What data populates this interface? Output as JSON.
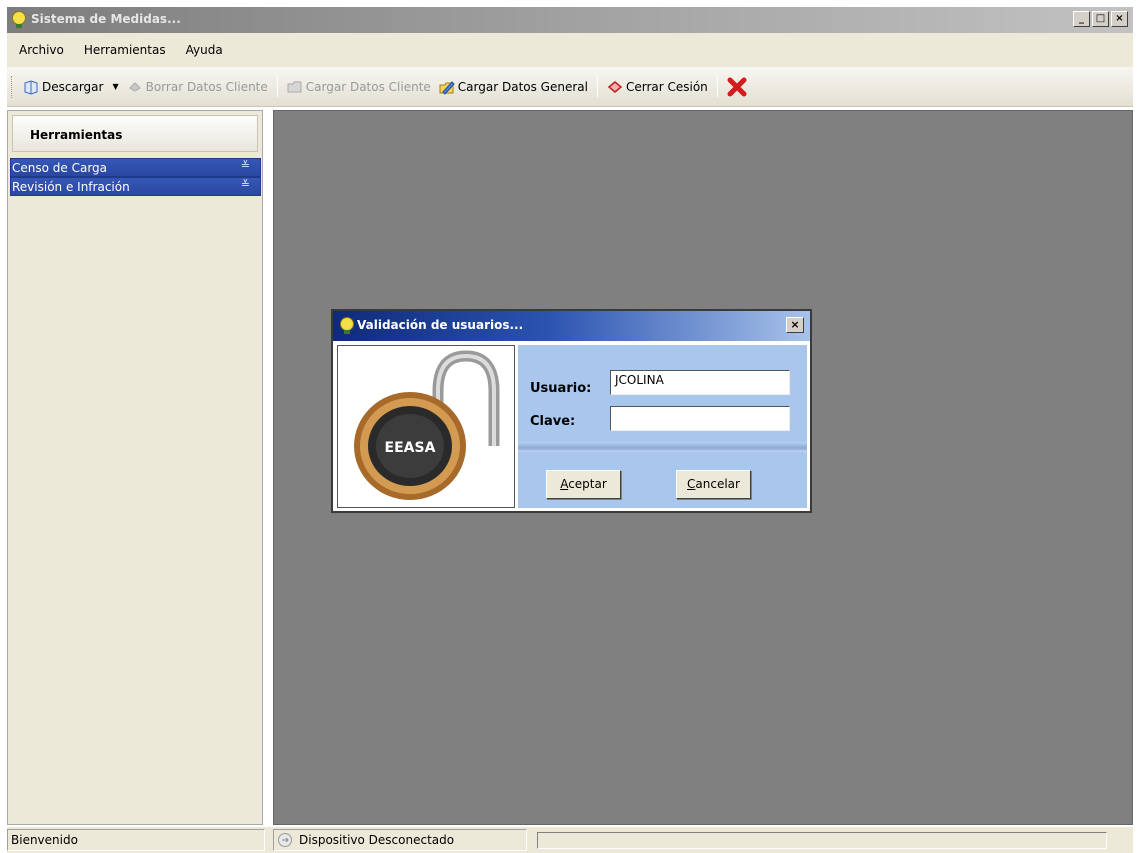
{
  "window": {
    "title": "Sistema de Medidas..."
  },
  "menu": {
    "items": [
      "Archivo",
      "Herramientas",
      "Ayuda"
    ]
  },
  "toolbar": {
    "download_label": "Descargar",
    "clear_client_label": "Borrar Datos Cliente",
    "load_client_label": "Cargar Datos Cliente",
    "load_general_label": "Cargar Datos General",
    "logout_label": "Cerrar Cesión"
  },
  "sidebar": {
    "header": "Herramientas",
    "items": [
      {
        "label": "Censo de Carga"
      },
      {
        "label": "Revisión e Infración"
      }
    ]
  },
  "dialog": {
    "title": "Validación de usuarios...",
    "user_label": "Usuario:",
    "user_value": "JCOLINA",
    "password_label": "Clave:",
    "password_value": "",
    "accept_mnemonic": "A",
    "accept_rest": "ceptar",
    "cancel_mnemonic": "C",
    "cancel_rest": "ancelar",
    "lock_brand": "EEASA"
  },
  "statusbar": {
    "welcome": "Bienvenido",
    "device": "Dispositivo Desconectado"
  },
  "colors": {
    "sidebar_item": "#3658b6",
    "main_bg": "#808080",
    "dialog_panel": "#a9c6ec",
    "dialog_title": "#0f2a7a"
  }
}
